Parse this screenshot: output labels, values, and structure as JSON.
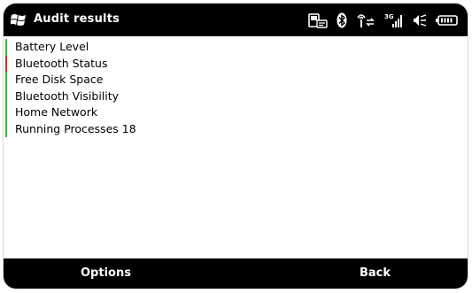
{
  "titlebar": {
    "title": "Audit results",
    "start_icon": "windows-flag-icon",
    "status_icons": [
      "phone-card-icon",
      "bluetooth-icon",
      "connectivity-icon",
      "3g-signal-icon",
      "speaker-muted-icon",
      "battery-icon"
    ],
    "network_label": "3G"
  },
  "list": {
    "items": [
      {
        "label": "Battery Level",
        "status_color": "#4caf50"
      },
      {
        "label": "Bluetooth Status",
        "status_color": "#d32f2f"
      },
      {
        "label": "Free Disk Space",
        "status_color": "#4caf50"
      },
      {
        "label": "Bluetooth Visibility",
        "status_color": "#4caf50"
      },
      {
        "label": "Home Network",
        "status_color": "#4caf50"
      },
      {
        "label": "Running Processes 18",
        "status_color": "#4caf50"
      }
    ]
  },
  "softkeys": {
    "left_label": "Options",
    "right_label": "Back"
  },
  "colors": {
    "bar_background": "#000000",
    "content_background": "#ffffff",
    "ok": "#4caf50",
    "alert": "#d32f2f"
  }
}
